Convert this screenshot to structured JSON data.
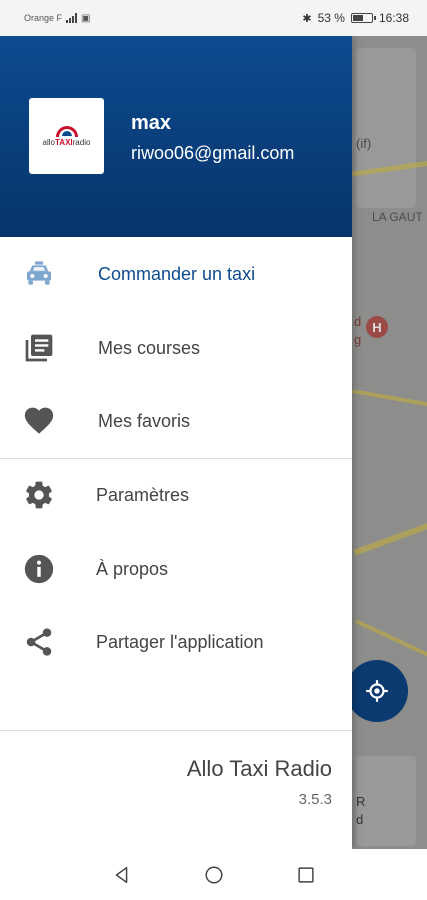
{
  "status_bar": {
    "carrier": "Orange F",
    "battery": "53 %",
    "battery_level": 0.53,
    "time": "16:38"
  },
  "drawer": {
    "logo": {
      "prefix": "allo",
      "brand": "TAXI",
      "suffix": "radio"
    },
    "user": {
      "name": "max",
      "email": "riwoo06@gmail.com"
    },
    "menu": [
      {
        "label": "Commander un taxi",
        "icon": "taxi-icon",
        "active": true
      },
      {
        "label": "Mes courses",
        "icon": "list-icon",
        "active": false
      },
      {
        "label": "Mes favoris",
        "icon": "heart-icon",
        "active": false
      },
      {
        "label": "Paramètres",
        "icon": "gear-icon",
        "active": false
      },
      {
        "label": "À propos",
        "icon": "info-icon",
        "active": false
      },
      {
        "label": "Partager l'application",
        "icon": "share-icon",
        "active": false
      }
    ],
    "app_name": "Allo Taxi Radio",
    "app_version": "3.5.3"
  },
  "map": {
    "labels": [
      "(if)",
      "LA GAUT",
      "d",
      "g",
      "R",
      "d"
    ]
  },
  "colors": {
    "header": "#0d4b8f",
    "accent": "#0d4b8f",
    "icon_active": "#7fa6cc",
    "icon_inactive": "#555555"
  }
}
